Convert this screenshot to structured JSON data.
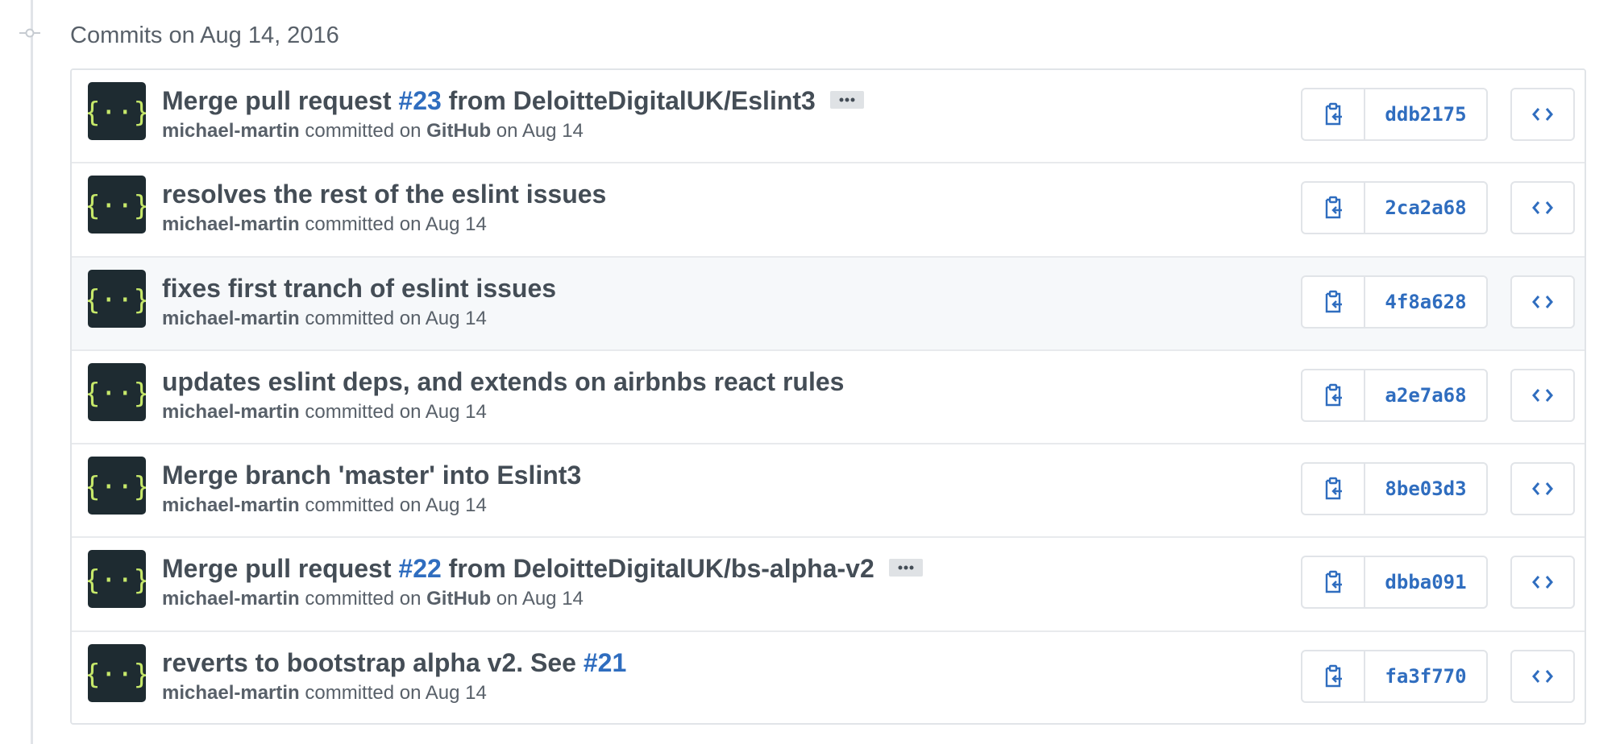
{
  "header": {
    "title": "Commits on Aug 14, 2016"
  },
  "commits": [
    {
      "title_pre": "Merge pull request ",
      "title_link": "#23",
      "title_post": " from DeloitteDigitalUK/Eslint3",
      "has_ellipsis": true,
      "author": "michael-martin",
      "committed_text": " committed on ",
      "committer": "GitHub",
      "date_text": " on Aug 14",
      "plain_date": "",
      "sha": "ddb2175"
    },
    {
      "title_pre": "resolves the rest of the eslint issues",
      "title_link": "",
      "title_post": "",
      "has_ellipsis": false,
      "author": "michael-martin",
      "committed_text": " committed on Aug 14",
      "committer": "",
      "date_text": "",
      "sha": "2ca2a68"
    },
    {
      "title_pre": "fixes first tranch of eslint issues",
      "title_link": "",
      "title_post": "",
      "has_ellipsis": false,
      "author": "michael-martin",
      "committed_text": " committed on Aug 14",
      "committer": "",
      "date_text": "",
      "sha": "4f8a628",
      "highlight": true
    },
    {
      "title_pre": "updates eslint deps, and extends on airbnbs react rules",
      "title_link": "",
      "title_post": "",
      "has_ellipsis": false,
      "author": "michael-martin",
      "committed_text": " committed on Aug 14",
      "committer": "",
      "date_text": "",
      "sha": "a2e7a68"
    },
    {
      "title_pre": "Merge branch 'master' into Eslint3",
      "title_link": "",
      "title_post": "",
      "has_ellipsis": false,
      "author": "michael-martin",
      "committed_text": " committed on Aug 14",
      "committer": "",
      "date_text": "",
      "sha": "8be03d3"
    },
    {
      "title_pre": "Merge pull request ",
      "title_link": "#22",
      "title_post": " from DeloitteDigitalUK/bs-alpha-v2",
      "has_ellipsis": true,
      "author": "michael-martin",
      "committed_text": " committed on ",
      "committer": "GitHub",
      "date_text": " on Aug 14",
      "sha": "dbba091"
    },
    {
      "title_pre": "reverts to bootstrap alpha v2. See ",
      "title_link": "#21",
      "title_post": "",
      "has_ellipsis": false,
      "author": "michael-martin",
      "committed_text": " committed on Aug 14",
      "committer": "",
      "date_text": "",
      "sha": "fa3f770"
    }
  ],
  "icons": {
    "timeline": "git-commit-icon",
    "avatar": "curly-braces-avatar-icon",
    "ellipsis": "ellipsis-icon",
    "copy": "clipboard-copy-icon",
    "browse": "code-browse-icon"
  },
  "colors": {
    "link": "#2f6dbf",
    "avatar_bg": "#1e2b31",
    "avatar_fg": "#c6e86a"
  }
}
